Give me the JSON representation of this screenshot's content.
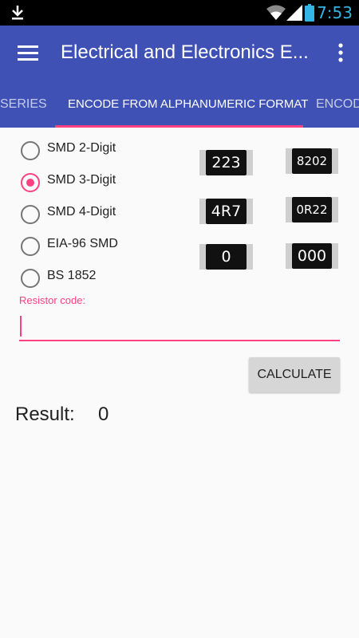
{
  "status_bar": {
    "time": "7:53",
    "icons": [
      "download-icon",
      "wifi-icon",
      "signal-icon",
      "battery-icon"
    ]
  },
  "app_bar": {
    "title": "Electrical and Electronics E...",
    "menu_icon": "hamburger-menu-icon",
    "overflow_icon": "more-vert-icon",
    "color": "#3f51b5"
  },
  "tabs": [
    {
      "label": "SERIES",
      "active": false
    },
    {
      "label": "ENCODE FROM ALPHANUMERIC FORMAT",
      "active": true
    },
    {
      "label": "ENCOD",
      "active": false
    }
  ],
  "accent_color": "#ff4081",
  "options": [
    {
      "label": "SMD 2-Digit",
      "checked": false
    },
    {
      "label": "SMD 3-Digit",
      "checked": true
    },
    {
      "label": "SMD 4-Digit",
      "checked": false
    },
    {
      "label": "EIA-96 SMD",
      "checked": false
    },
    {
      "label": "BS 1852",
      "checked": false
    }
  ],
  "resistor_examples": [
    "223",
    "8202",
    "4R7",
    "0R22",
    "0",
    "000"
  ],
  "input": {
    "label": "Resistor code:",
    "value": ""
  },
  "calculate_button": "CALCULATE",
  "result": {
    "label": "Result:",
    "value": "0"
  }
}
